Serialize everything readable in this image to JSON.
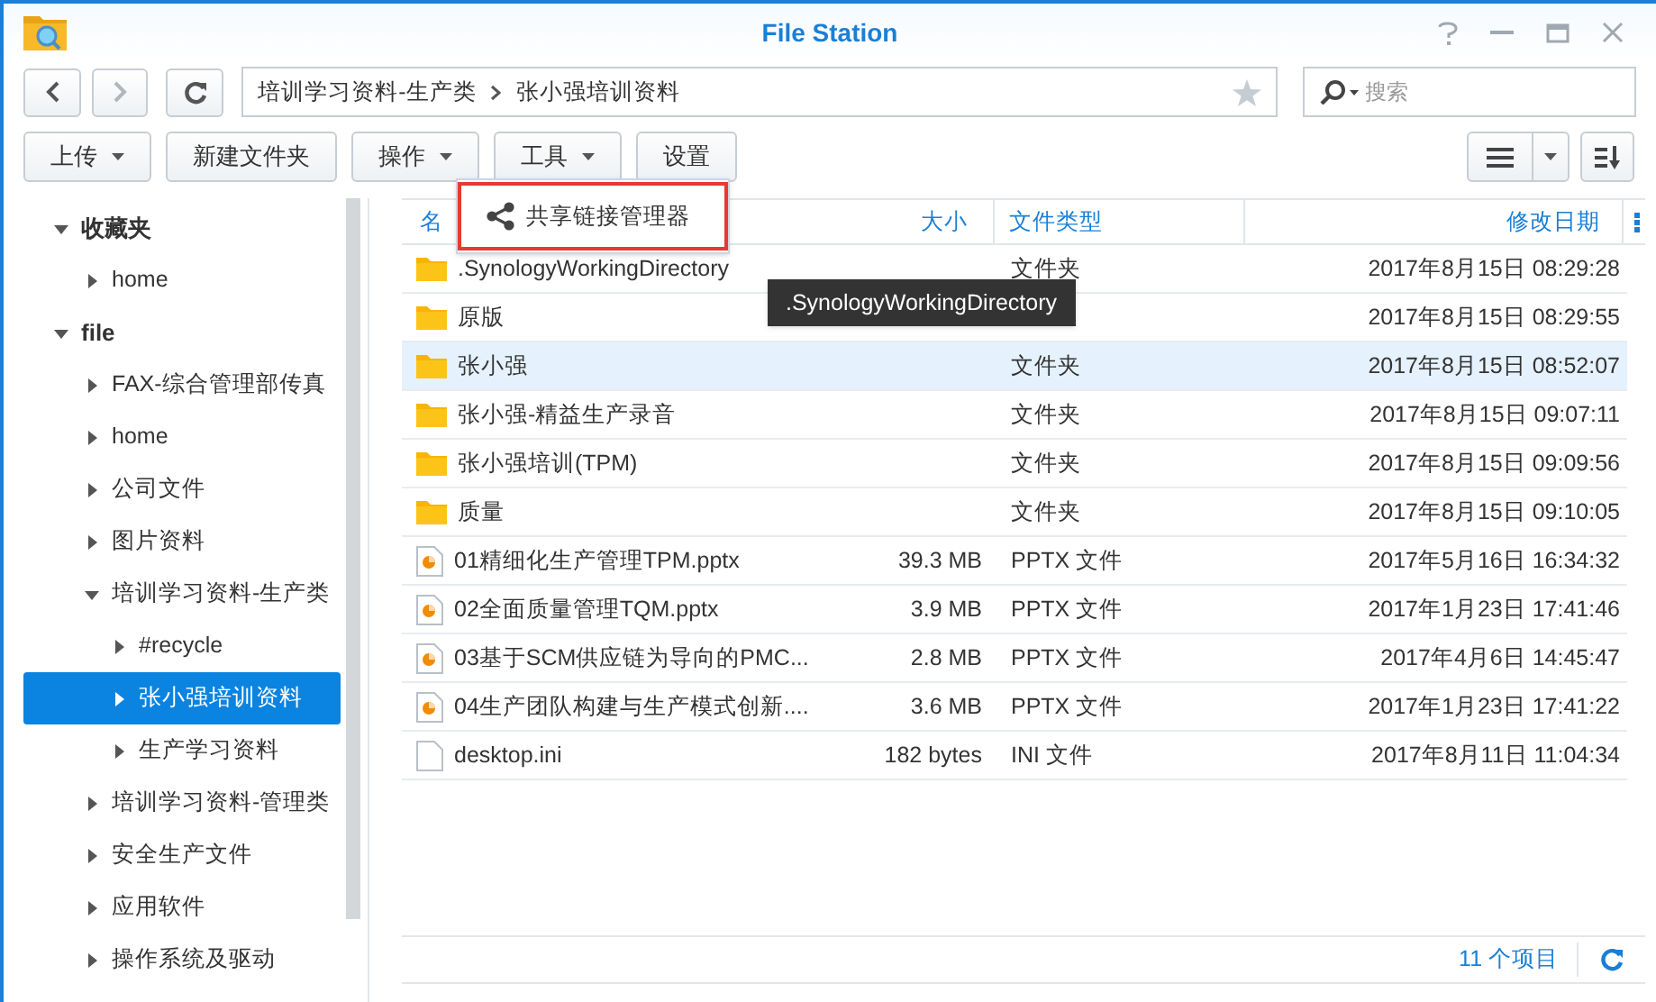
{
  "window": {
    "title": "File Station"
  },
  "nav": {
    "path": [
      "培训学习资料-生产类",
      "张小强培训资料"
    ],
    "search_placeholder": "搜索"
  },
  "toolbar": [
    {
      "label": "上传",
      "dropdown": true,
      "open": false
    },
    {
      "label": "新建文件夹",
      "dropdown": false,
      "open": false
    },
    {
      "label": "操作",
      "dropdown": true,
      "open": false
    },
    {
      "label": "工具",
      "dropdown": true,
      "open": true
    },
    {
      "label": "设置",
      "dropdown": false,
      "open": false
    }
  ],
  "menu": {
    "items": [
      {
        "label": "共享链接管理器",
        "highlighted": true
      }
    ]
  },
  "sidebar": [
    {
      "label": "收藏夹",
      "expanded": true,
      "bold": true,
      "selected": false,
      "children": [
        {
          "label": "home",
          "expanded": false,
          "bold": false,
          "selected": false
        }
      ]
    },
    {
      "label": "file",
      "expanded": true,
      "bold": true,
      "selected": false,
      "children": [
        {
          "label": "FAX-综合管理部传真",
          "expanded": false,
          "bold": false,
          "selected": false
        },
        {
          "label": "home",
          "expanded": false,
          "bold": false,
          "selected": false
        },
        {
          "label": "公司文件",
          "expanded": false,
          "bold": false,
          "selected": false
        },
        {
          "label": "图片资料",
          "expanded": false,
          "bold": false,
          "selected": false
        },
        {
          "label": "培训学习资料-生产类",
          "expanded": true,
          "bold": false,
          "selected": false,
          "children": [
            {
              "label": "#recycle",
              "expanded": false,
              "bold": false,
              "selected": false
            },
            {
              "label": "张小强培训资料",
              "expanded": false,
              "bold": false,
              "selected": true
            },
            {
              "label": "生产学习资料",
              "expanded": false,
              "bold": false,
              "selected": false
            }
          ]
        },
        {
          "label": "培训学习资料-管理类",
          "expanded": false,
          "bold": false,
          "selected": false
        },
        {
          "label": "安全生产文件",
          "expanded": false,
          "bold": false,
          "selected": false
        },
        {
          "label": "应用软件",
          "expanded": false,
          "bold": false,
          "selected": false
        },
        {
          "label": "操作系统及驱动",
          "expanded": false,
          "bold": false,
          "selected": false
        }
      ]
    }
  ],
  "table": {
    "columns": [
      "名",
      "大小",
      "文件类型",
      "修改日期"
    ],
    "rows": [
      {
        "kind": "folder",
        "name": ".SynologyWorkingDirectory",
        "type": "文件夹",
        "date": "2017年8月15日 08:29:28",
        "selected": false
      },
      {
        "kind": "folder",
        "name": "原版",
        "date": "2017年8月15日 08:29:55",
        "selected": false
      },
      {
        "kind": "folder",
        "name": "张小强",
        "type": "文件夹",
        "date": "2017年8月15日 08:52:07",
        "selected": true
      },
      {
        "kind": "folder",
        "name": "张小强-精益生产录音",
        "type": "文件夹",
        "date": "2017年8月15日 09:07:11",
        "selected": false
      },
      {
        "kind": "folder",
        "name": "张小强培训(TPM)",
        "type": "文件夹",
        "date": "2017年8月15日 09:09:56",
        "selected": false
      },
      {
        "kind": "folder",
        "name": "质量",
        "type": "文件夹",
        "date": "2017年8月15日 09:10:05",
        "selected": false
      },
      {
        "kind": "pptx",
        "name": "01精细化生产管理TPM.pptx",
        "size": "39.3 MB",
        "type": "PPTX 文件",
        "date": "2017年5月16日 16:34:32",
        "selected": false
      },
      {
        "kind": "pptx",
        "name": "02全面质量管理TQM.pptx",
        "size": "3.9 MB",
        "type": "PPTX 文件",
        "date": "2017年1月23日 17:41:46",
        "selected": false
      },
      {
        "kind": "pptx",
        "name": "03基于SCM供应链为导向的PMC...",
        "size": "2.8 MB",
        "type": "PPTX 文件",
        "date": "2017年4月6日 14:45:47",
        "selected": false
      },
      {
        "kind": "pptx",
        "name": "04生产团队构建与生产模式创新....",
        "size": "3.6 MB",
        "type": "PPTX 文件",
        "date": "2017年1月23日 17:41:22",
        "selected": false
      },
      {
        "kind": "ini",
        "name": "desktop.ini",
        "size": "182 bytes",
        "type": "INI 文件",
        "date": "2017年8月11日 11:04:34",
        "selected": false
      }
    ]
  },
  "tooltip": ".SynologyWorkingDirectory",
  "status_bar": {
    "count": "11 个项目"
  }
}
